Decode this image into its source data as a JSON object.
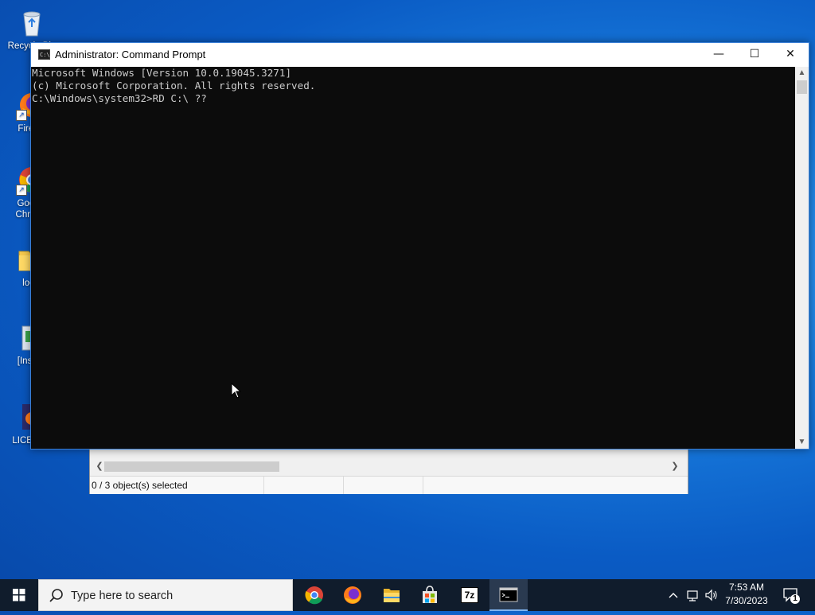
{
  "desktop": {
    "icons": [
      {
        "label": "Recycle Bin",
        "icon": "recycle-bin-icon"
      },
      {
        "label": "Firefox",
        "icon": "firefox-icon"
      },
      {
        "label": "Google Chrome",
        "icon": "chrome-icon"
      },
      {
        "label": "local",
        "icon": "folder-icon"
      },
      {
        "label": "[Install]",
        "icon": "installer-icon"
      },
      {
        "label": "LICENSE",
        "icon": "license-icon"
      }
    ]
  },
  "explorer": {
    "status_text": "0 / 3 object(s) selected"
  },
  "cmd": {
    "title": "Administrator: Command Prompt",
    "app_icon_text": "C:\\",
    "lines": [
      "Microsoft Windows [Version 10.0.19045.3271]",
      "(c) Microsoft Corporation. All rights reserved.",
      "",
      "C:\\Windows\\system32>RD C:\\ ??"
    ],
    "minimize_glyph": "—",
    "maximize_glyph": "☐",
    "close_glyph": "✕"
  },
  "taskbar": {
    "search_placeholder": "Type here to search",
    "apps": [
      "chrome",
      "firefox",
      "file-explorer",
      "microsoft-store",
      "7zip",
      "command-prompt"
    ],
    "sevenzip_label": "7z",
    "clock_time": "7:53 AM",
    "clock_date": "7/30/2023",
    "notification_count": "1",
    "colors": {
      "accent": "#7fb4ef",
      "taskbar_bg": "#101c2c"
    }
  }
}
